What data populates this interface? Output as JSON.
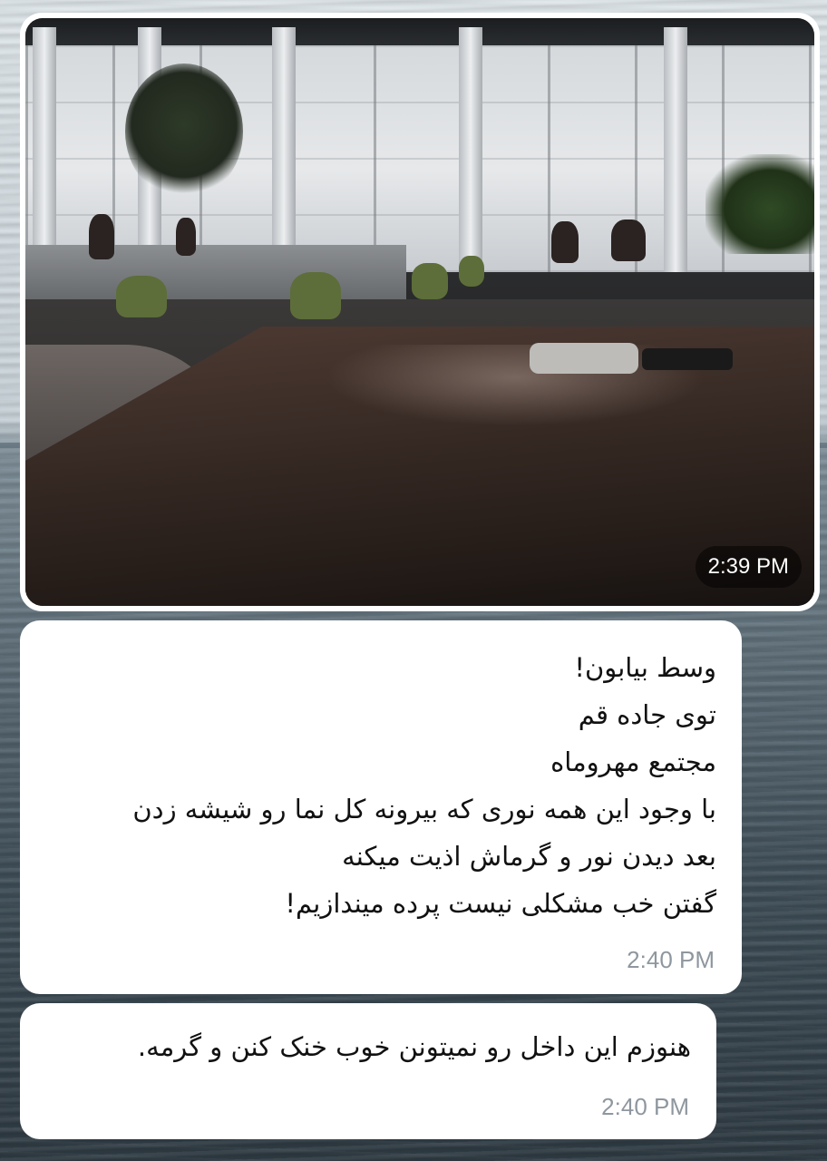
{
  "chat": {
    "photo_message": {
      "image_alt": "Dim cafeteria interior with a dark wooden table in the foreground and large bright windows in the background",
      "time": "2:39 PM"
    },
    "messages": [
      {
        "lines": [
          "وسط بیابون!",
          "توی جاده قم",
          "مجتمع مهروماه",
          "با وجود این همه نوری که بیرونه کل نما رو شیشه زدن",
          "بعد دیدن نور و گرماش اذیت میکنه",
          "گفتن خب مشکلی نیست پرده میندازیم!"
        ],
        "time": "2:40 PM"
      },
      {
        "lines": [
          "هنوزم این داخل رو نمیتونن خوب خنک کنن و گرمه."
        ],
        "time": "2:40 PM"
      }
    ]
  },
  "colors": {
    "bubble": "#ffffff",
    "time_text": "#8e979f",
    "message_text": "#111111",
    "time_pill_bg": "rgba(0,0,0,0.5)"
  }
}
